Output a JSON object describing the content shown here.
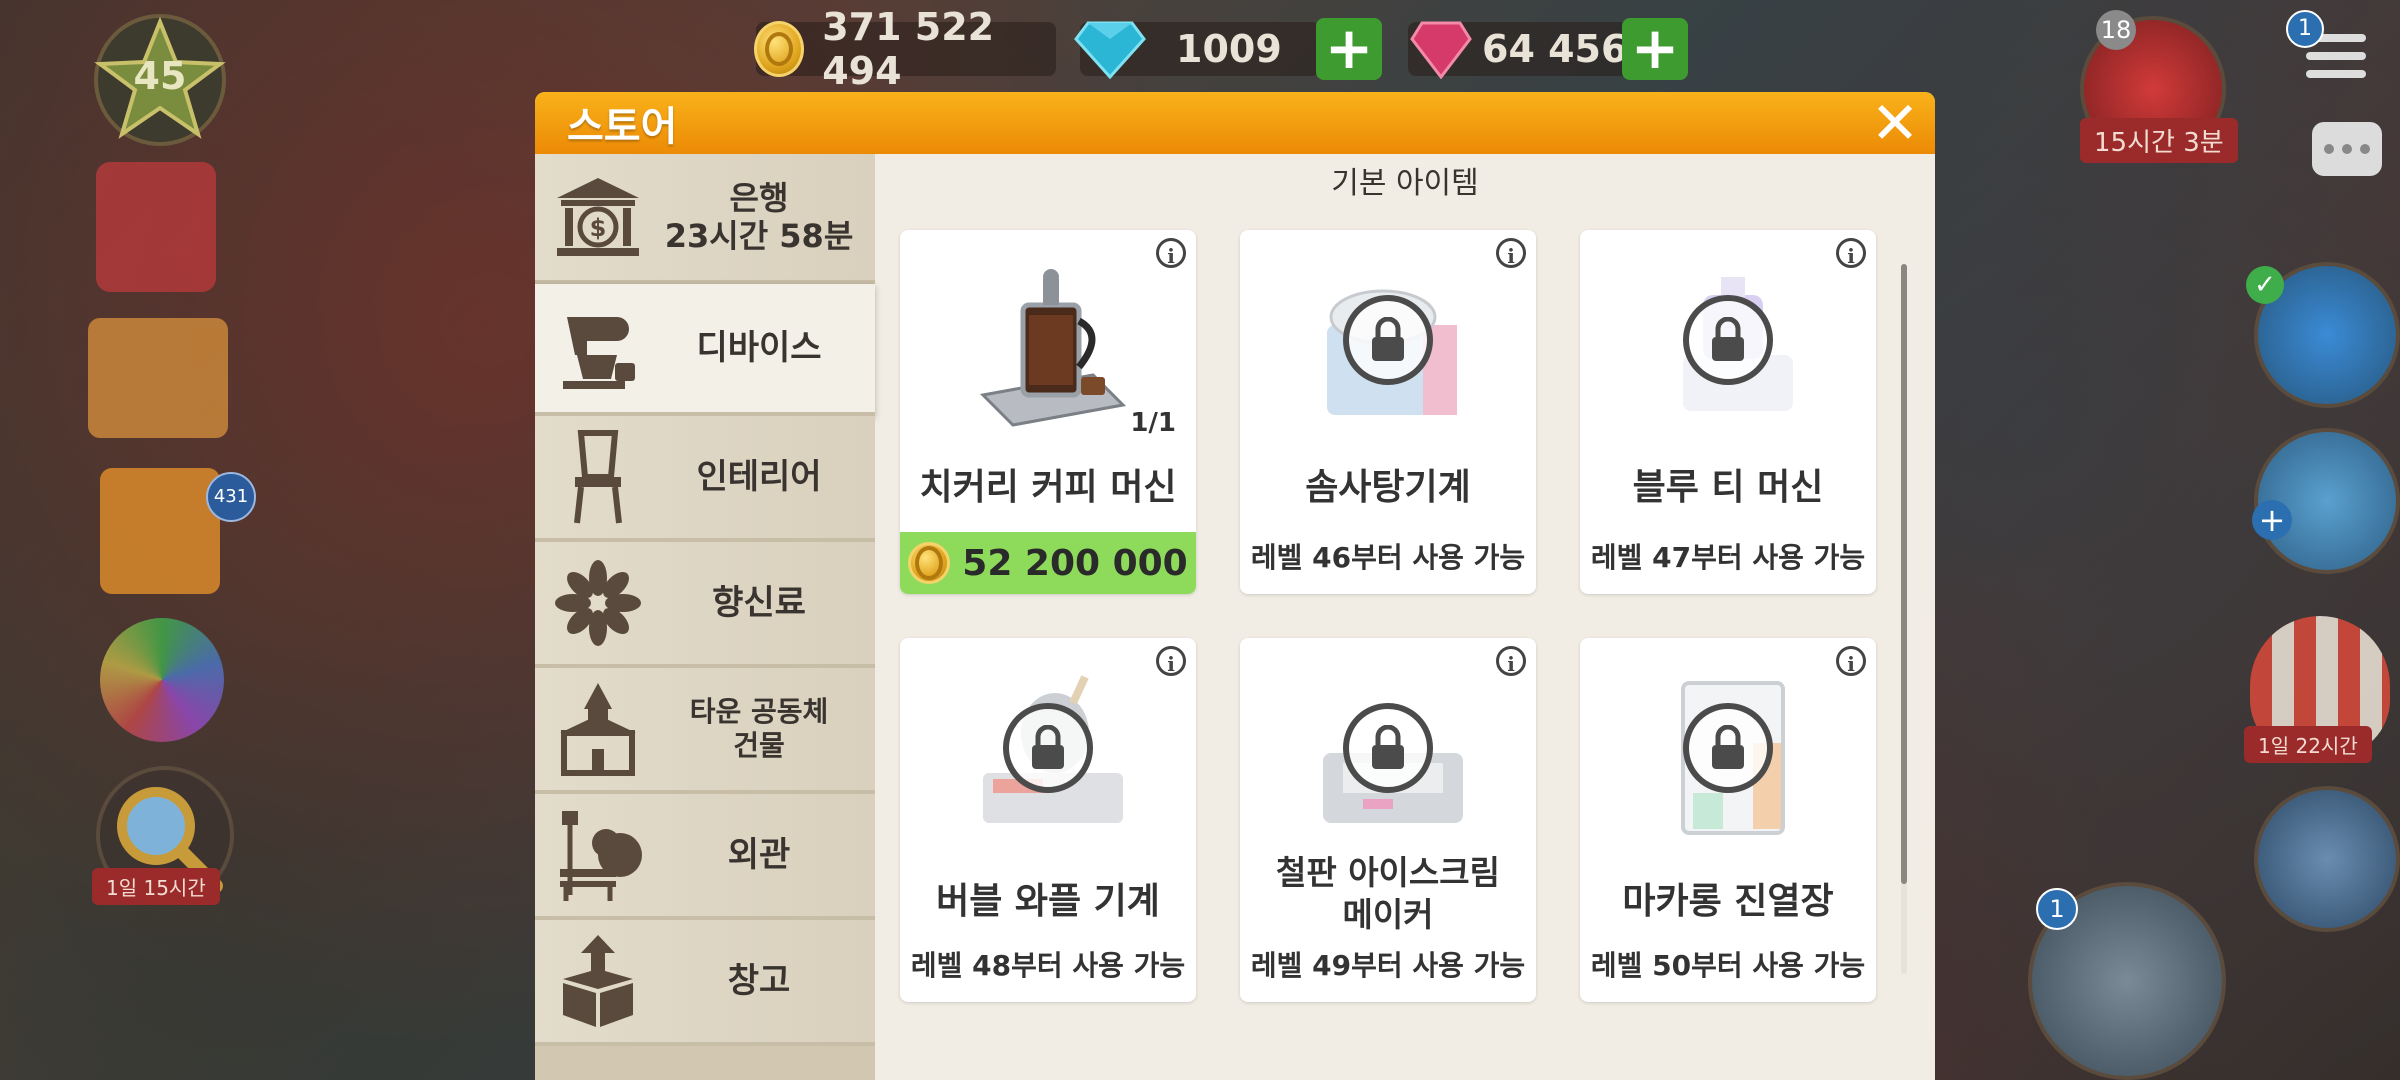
{
  "hud": {
    "level": "45",
    "coins": "371 522 494",
    "diamonds": "1009",
    "gems": "64 456",
    "notification_count": "431",
    "left_timer": "1일 15시간",
    "gift_badge": "18",
    "gift_timer": "15시간 3분",
    "menu_badge": "1",
    "balloon_timer": "1일 22시간",
    "register_badge": "1"
  },
  "store": {
    "title": "스토어",
    "section_title": "기본 아이템",
    "sidebar": [
      {
        "line1": "은행",
        "line2": "23시간 58분"
      },
      {
        "line1": "디바이스"
      },
      {
        "line1": "인테리어"
      },
      {
        "line1": "향신료"
      },
      {
        "line1": "타운 공동체",
        "line2": "건물"
      },
      {
        "line1": "외관"
      },
      {
        "line1": "창고"
      }
    ],
    "items": [
      {
        "name": "치커리 커피 머신",
        "count": "1/1",
        "price": "52 200 000"
      },
      {
        "name": "솜사탕기계",
        "requirement": "레벨 46부터 사용 가능"
      },
      {
        "name": "블루 티 머신",
        "requirement": "레벨 47부터 사용 가능"
      },
      {
        "name": "버블 와플 기계",
        "requirement": "레벨 48부터 사용 가능"
      },
      {
        "name_line1": "철판 아이스크림",
        "name_line2": "메이커",
        "requirement": "레벨 49부터 사용 가능"
      },
      {
        "name": "마카롱 진열장",
        "requirement": "레벨 50부터 사용 가능"
      }
    ]
  },
  "colors": {
    "header": "#f39c12",
    "price_bg": "#8edb5c",
    "panel": "#f1ede4"
  }
}
